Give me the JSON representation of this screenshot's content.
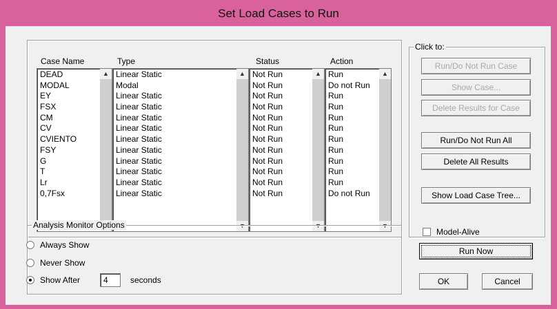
{
  "window": {
    "title": "Set Load Cases to Run"
  },
  "headers": {
    "case_name": "Case Name",
    "type": "Type",
    "status": "Status",
    "action": "Action"
  },
  "cases": [
    {
      "name": "DEAD",
      "type": "Linear Static",
      "status": "Not Run",
      "action": "Run"
    },
    {
      "name": "MODAL",
      "type": "Modal",
      "status": "Not Run",
      "action": "Do not Run"
    },
    {
      "name": "EY",
      "type": "Linear Static",
      "status": "Not Run",
      "action": "Run"
    },
    {
      "name": "FSX",
      "type": "Linear Static",
      "status": "Not Run",
      "action": "Run"
    },
    {
      "name": "CM",
      "type": "Linear Static",
      "status": "Not Run",
      "action": "Run"
    },
    {
      "name": "CV",
      "type": "Linear Static",
      "status": "Not Run",
      "action": "Run"
    },
    {
      "name": "CVIENTO",
      "type": "Linear Static",
      "status": "Not Run",
      "action": "Run"
    },
    {
      "name": "FSY",
      "type": "Linear Static",
      "status": "Not Run",
      "action": "Run"
    },
    {
      "name": "G",
      "type": "Linear Static",
      "status": "Not Run",
      "action": "Run"
    },
    {
      "name": "T",
      "type": "Linear Static",
      "status": "Not Run",
      "action": "Run"
    },
    {
      "name": "Lr",
      "type": "Linear Static",
      "status": "Not Run",
      "action": "Run"
    },
    {
      "name": "0,7Fsx",
      "type": "Linear Static",
      "status": "Not Run",
      "action": "Do not Run"
    }
  ],
  "click_to": {
    "title": "Click to:",
    "run_do_not_run_case": "Run/Do Not Run Case",
    "show_case": "Show Case...",
    "delete_results_for_case": "Delete Results for Case",
    "run_do_not_run_all": "Run/Do Not Run All",
    "delete_all_results": "Delete All Results",
    "show_load_case_tree": "Show Load Case Tree..."
  },
  "monitor": {
    "title": "Analysis Monitor Options",
    "always_show": "Always Show",
    "never_show": "Never Show",
    "show_after": "Show After",
    "show_after_value": "4",
    "seconds": "seconds",
    "selected": "show_after"
  },
  "model_alive": {
    "label": "Model-Alive",
    "checked": false
  },
  "buttons": {
    "run_now": "Run Now",
    "ok": "OK",
    "cancel": "Cancel"
  }
}
